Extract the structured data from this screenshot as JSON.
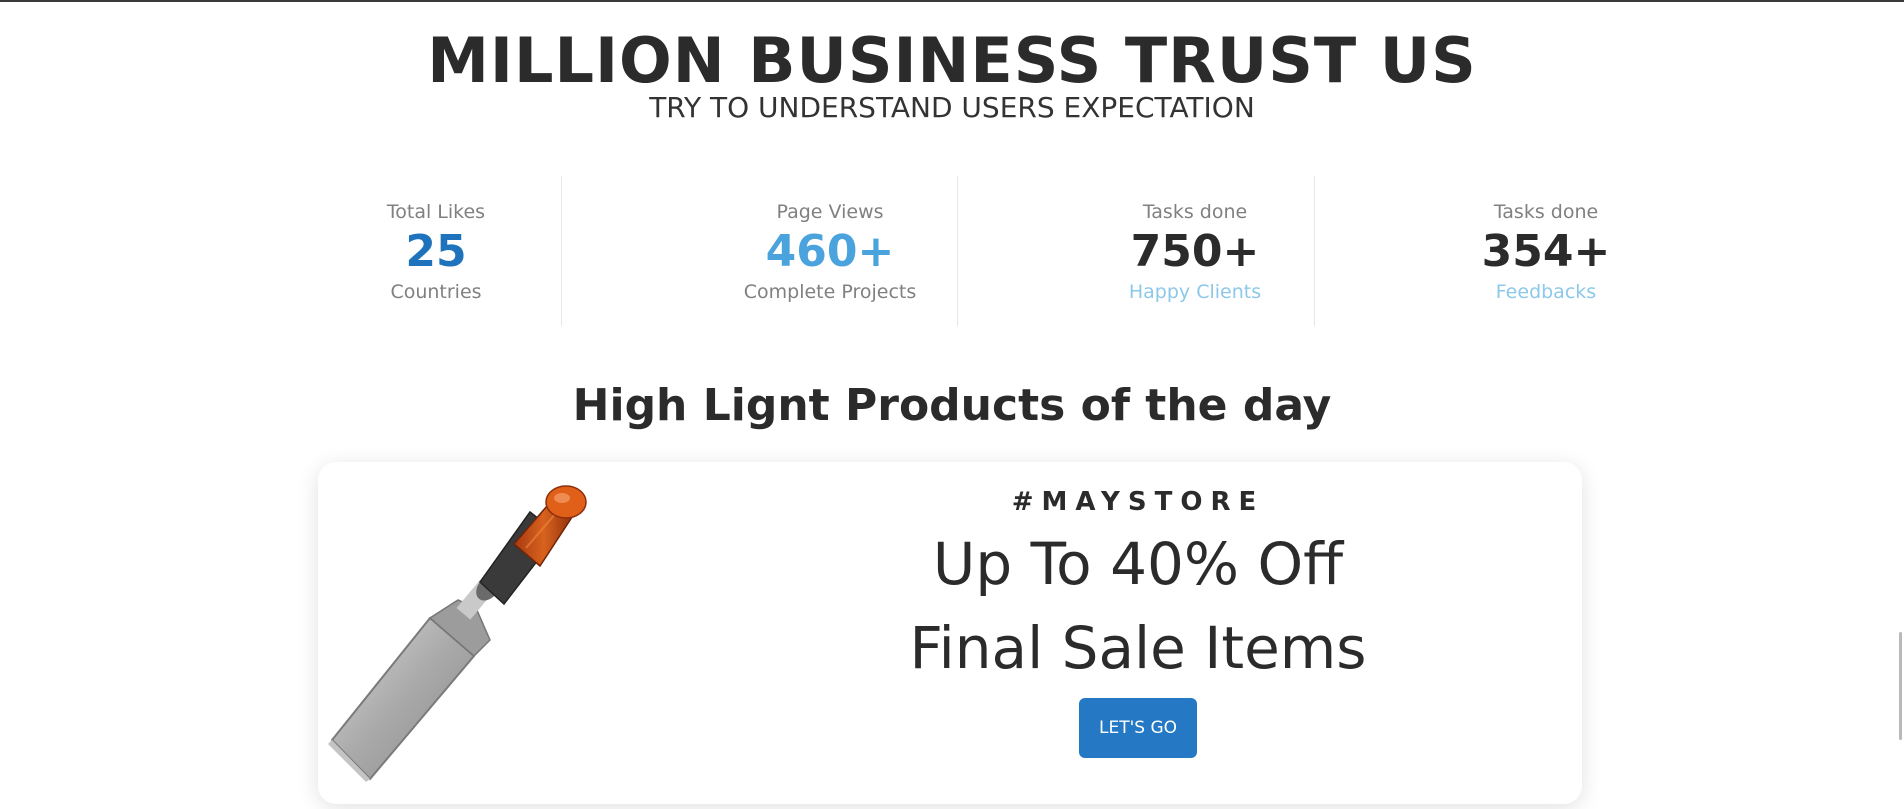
{
  "hero": {
    "title": "MILLION BUSINESS TRUST US",
    "subtitle": "TRY TO UNDERSTAND USERS EXPECTATION"
  },
  "stats": [
    {
      "label": "Total Likes",
      "value": "25",
      "caption": "Countries",
      "value_color": "#1f73bd",
      "caption_color": "#808080"
    },
    {
      "label": "Page Views",
      "value": "460+",
      "caption": "Complete Projects",
      "value_color": "#4aa3dc",
      "caption_color": "#808080"
    },
    {
      "label": "Tasks done",
      "value": "750+",
      "caption": "Happy Clients",
      "value_color": "#2b2b2b",
      "caption_color": "#8cc8ea"
    },
    {
      "label": "Tasks done",
      "value": "354+",
      "caption": "Feedbacks",
      "value_color": "#2b2b2b",
      "caption_color": "#8cc8ea"
    }
  ],
  "highlight": {
    "title": "High Lignt Products of the day"
  },
  "promo": {
    "tag": "#MAYSTORE",
    "line1": "Up To 40% Off",
    "line2": "Final Sale Items",
    "button_label": "LET'S GO",
    "button_color": "#2579c4",
    "image_icon": "chisel-icon"
  }
}
